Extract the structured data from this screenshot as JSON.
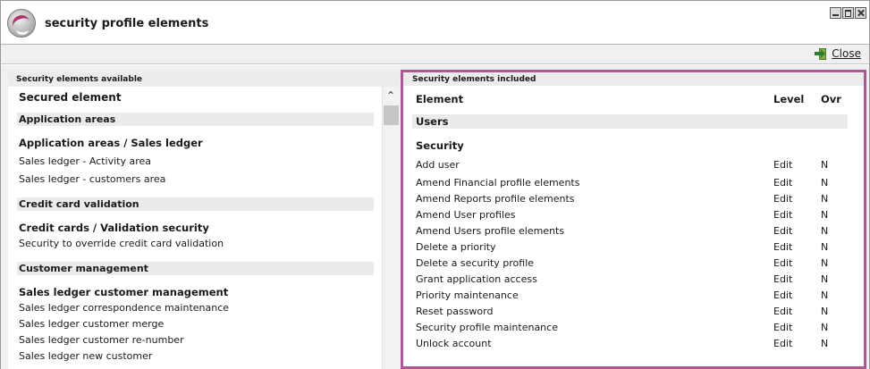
{
  "window": {
    "title": "security profile elements"
  },
  "toolbar": {
    "close_label": "Close"
  },
  "available": {
    "caption": "Security elements available",
    "header": "Secured element",
    "groups": [
      {
        "label": "Application areas"
      },
      {
        "label": "Credit card validation"
      },
      {
        "label": "Customer management"
      }
    ],
    "subgroups": [
      {
        "label": "Application areas / Sales ledger"
      },
      {
        "label": "Credit cards / Validation security"
      },
      {
        "label": "Sales ledger customer management"
      }
    ],
    "items": [
      "Sales ledger - Activity area",
      "Sales ledger - customers area",
      "Security to override credit card validation",
      "Sales ledger correspondence maintenance",
      "Sales ledger customer merge",
      "Sales ledger customer re-number",
      "Sales ledger new customer"
    ]
  },
  "included": {
    "caption": "Security elements included",
    "columns": {
      "element": "Element",
      "level": "Level",
      "ovr": "Ovr"
    },
    "group": "Users",
    "subgroup": "Security",
    "rows": [
      {
        "element": "Add user",
        "level": "Edit",
        "ovr": "N"
      },
      {
        "element": "Amend Financial profile elements",
        "level": "Edit",
        "ovr": "N"
      },
      {
        "element": "Amend Reports profile elements",
        "level": "Edit",
        "ovr": "N"
      },
      {
        "element": "Amend User profiles",
        "level": "Edit",
        "ovr": "N"
      },
      {
        "element": "Amend Users profile elements",
        "level": "Edit",
        "ovr": "N"
      },
      {
        "element": "Delete a priority",
        "level": "Edit",
        "ovr": "N"
      },
      {
        "element": "Delete a security profile",
        "level": "Edit",
        "ovr": "N"
      },
      {
        "element": "Grant application access",
        "level": "Edit",
        "ovr": "N"
      },
      {
        "element": "Priority maintenance",
        "level": "Edit",
        "ovr": "N"
      },
      {
        "element": "Reset password",
        "level": "Edit",
        "ovr": "N"
      },
      {
        "element": "Security profile maintenance",
        "level": "Edit",
        "ovr": "N"
      },
      {
        "element": "Unlock account",
        "level": "Edit",
        "ovr": "N"
      }
    ]
  },
  "icons": {
    "app_logo": "app-logo-icon",
    "minimize": "minimize-icon",
    "maximize": "maximize-icon",
    "close_window": "close-icon",
    "exit": "exit-icon",
    "scroll_up": "chevron-up-icon"
  },
  "colors": {
    "included_border": "#a95a93",
    "group_band": "#ebebeb"
  }
}
